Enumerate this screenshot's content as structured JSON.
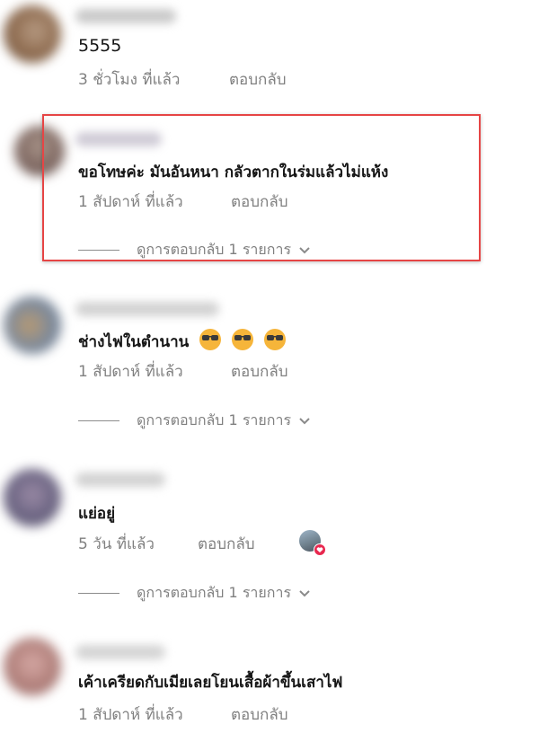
{
  "comments": [
    {
      "text": "5555",
      "time": "3 ชั่วโมง ที่แล้ว",
      "reply_label": "ตอบกลับ"
    },
    {
      "text": "ขอโทษค่ะ มันอันหนา กลัวตากในร่มแล้วไม่แห้ง",
      "time": "1 สัปดาห์ ที่แล้ว",
      "reply_label": "ตอบกลับ",
      "view_replies": "ดูการตอบกลับ 1 รายการ"
    },
    {
      "text": "ช่างไฟในตำนาน",
      "emoji": "smiling-face-with-sunglasses",
      "emoji_count": 3,
      "time": "1 สัปดาห์ ที่แล้ว",
      "reply_label": "ตอบกลับ",
      "view_replies": "ดูการตอบกลับ 1 รายการ"
    },
    {
      "text": "แย่อยู่",
      "time": "5 วัน ที่แล้ว",
      "reply_label": "ตอบกลับ",
      "reaction_icon": "heart-icon",
      "view_replies": "ดูการตอบกลับ 1 รายการ"
    },
    {
      "text": "เค้าเครียดกับเมียเลยโยนเสื้อผ้าขึ้นเสาไฟ",
      "time": "1 สัปดาห์ ที่แล้ว",
      "reply_label": "ตอบกลับ"
    }
  ],
  "colors": {
    "highlight_border": "#e64545",
    "meta_text": "#808080",
    "body_text": "#161616",
    "heart": "#e8284f"
  }
}
